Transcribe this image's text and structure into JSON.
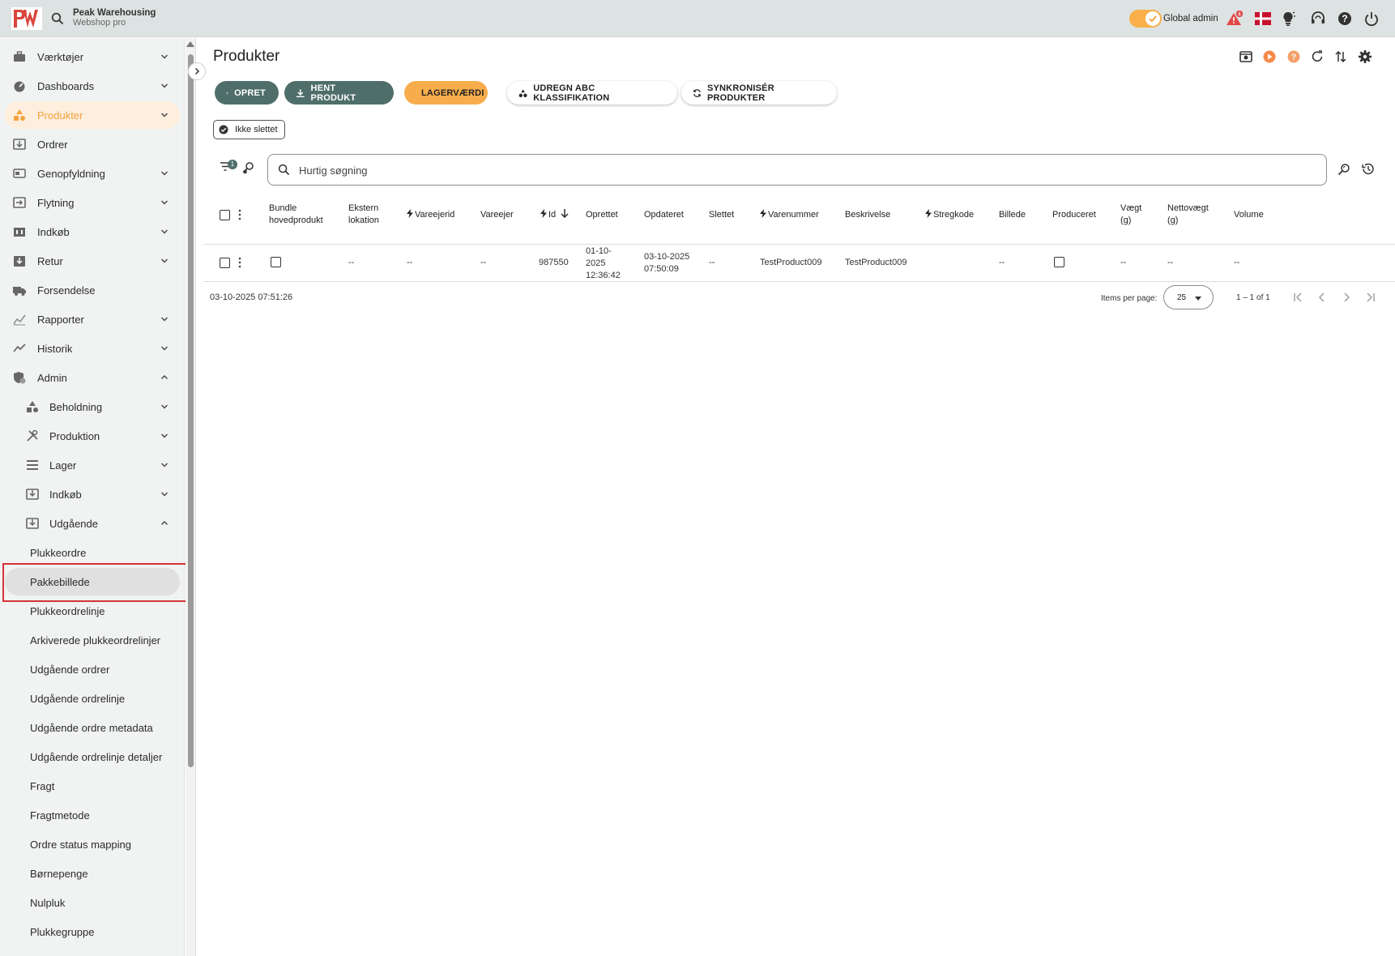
{
  "topbar": {
    "brand_name": "Peak Warehousing",
    "brand_sub": "Webshop pro",
    "global_admin": "Global admin",
    "notification_count": "4",
    "toggle_on": true,
    "colors": {
      "accent": "#f9b04a",
      "alert": "#e04a4a"
    }
  },
  "sidebar": {
    "items": [
      {
        "label": "Værktøjer",
        "icon": "toolbox-icon",
        "expandable": true
      },
      {
        "label": "Dashboards",
        "icon": "dashboard-icon",
        "expandable": true
      },
      {
        "label": "Produkter",
        "icon": "shapes-icon",
        "expandable": true,
        "active": true
      },
      {
        "label": "Ordrer",
        "icon": "order-icon",
        "expandable": false
      },
      {
        "label": "Genopfyldning",
        "icon": "refill-icon",
        "expandable": true
      },
      {
        "label": "Flytning",
        "icon": "move-icon",
        "expandable": true
      },
      {
        "label": "Indkøb",
        "icon": "store-icon",
        "expandable": true
      },
      {
        "label": "Retur",
        "icon": "return-icon",
        "expandable": true
      },
      {
        "label": "Forsendelse",
        "icon": "truck-icon",
        "expandable": false
      },
      {
        "label": "Rapporter",
        "icon": "chart-icon",
        "expandable": true
      },
      {
        "label": "Historik",
        "icon": "trend-icon",
        "expandable": true
      },
      {
        "label": "Admin",
        "icon": "admin-icon",
        "expandable": true,
        "expanded": true
      }
    ],
    "admin_children": [
      {
        "label": "Beholdning",
        "icon": "shapes-icon"
      },
      {
        "label": "Produktion",
        "icon": "tools-icon"
      },
      {
        "label": "Lager",
        "icon": "list-icon"
      },
      {
        "label": "Indkøb",
        "icon": "inbox-in-icon"
      },
      {
        "label": "Udgående",
        "icon": "inbox-out-icon",
        "expanded": true
      }
    ],
    "udgaaende_children": [
      "Plukkeordre",
      "Pakkebillede",
      "Plukkeordrelinje",
      "Arkiverede plukkeordrelinjer",
      "Udgående ordrer",
      "Udgående ordrelinje",
      "Udgående ordre metadata",
      "Udgående ordrelinje detaljer",
      "Fragt",
      "Fragtmetode",
      "Ordre status mapping",
      "Børnepenge",
      "Nulpluk",
      "Plukkegruppe"
    ],
    "selected": "Pakkebillede"
  },
  "main": {
    "title": "Produkter",
    "buttons": {
      "create": "OPRET",
      "fetch": "HENT PRODUKT",
      "stock_value": "LAGERVÆRDI",
      "abc": "UDREGN ABC KLASSIFIKATION",
      "sync": "SYNKRONISÉR PRODUKTER"
    },
    "filter_chip": "Ikke slettet",
    "filter_count": "1",
    "search": {
      "placeholder": "Hurtig søgning",
      "value": ""
    },
    "table": {
      "headers": {
        "bundle_l1": "Bundle",
        "bundle_l2": "hovedprodukt",
        "ext_l1": "Ekstern",
        "ext_l2": "lokation",
        "owner_id": "Vareejerid",
        "owner": "Vareejer",
        "id": "Id",
        "created": "Oprettet",
        "updated": "Opdateret",
        "deleted": "Slettet",
        "itemno": "Varenummer",
        "desc": "Beskrivelse",
        "barcode": "Stregkode",
        "image": "Billede",
        "produced": "Produceret",
        "weight_l1": "Vægt",
        "weight_l2": "(g)",
        "net_l1": "Nettovægt",
        "net_l2": "(g)",
        "volume": "Volume"
      },
      "rows": [
        {
          "ext": "--",
          "owner_id": "--",
          "owner": "--",
          "id": "987550",
          "created_l1": "01-10-",
          "created_l2": "2025",
          "created_l3": "12:36:42",
          "updated_l1": "03-10-2025",
          "updated_l2": "07:50:09",
          "deleted": "--",
          "itemno": "TestProduct009",
          "desc": "TestProduct009",
          "barcode": "",
          "image": "--",
          "weight": "--",
          "net": "--",
          "volume": "--"
        }
      ]
    },
    "footer": {
      "timestamp": "03-10-2025 07:51:26",
      "items_per_page_label": "Items per page:",
      "items_per_page": "25",
      "range": "1 – 1 of 1"
    }
  }
}
